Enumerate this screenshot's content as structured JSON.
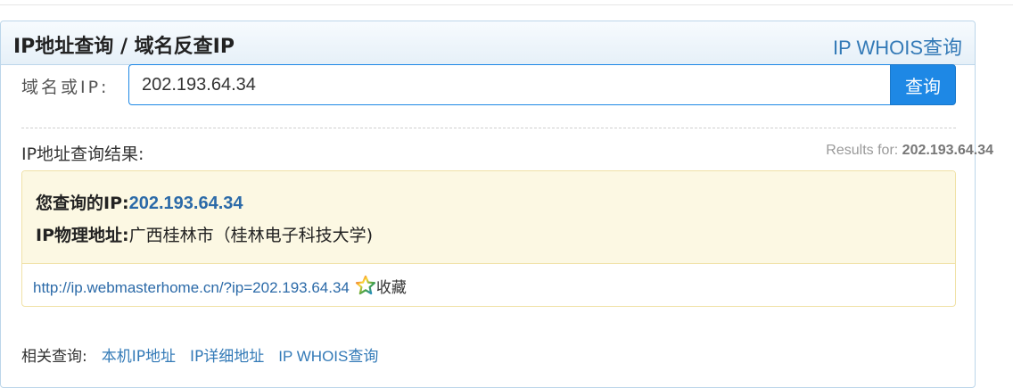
{
  "header": {
    "title": "IP地址查询 / 域名反查IP",
    "whois_link": "IP WHOIS查询"
  },
  "query": {
    "label": "域名或IP:",
    "value": "202.193.64.34",
    "button": "查询"
  },
  "results": {
    "label": "IP地址查询结果:",
    "results_for_prefix": "Results for:",
    "results_for_value": "202.193.64.34",
    "ip_key": "您查询的IP:",
    "ip_value": "202.193.64.34",
    "location_key": "IP物理地址:",
    "location_value": "广西桂林市（桂林电子科技大学)",
    "permalink": "http://ip.webmasterhome.cn/?ip=202.193.64.34",
    "favorite_icon": "star-icon",
    "favorite_label": "收藏"
  },
  "related": {
    "label": "相关查询:",
    "links": [
      "本机IP地址",
      "IP详细地址",
      "IP WHOIS查询"
    ]
  },
  "colors": {
    "accent": "#1e88e5",
    "link": "#337ab7",
    "result_bg": "#fcf8e3"
  }
}
